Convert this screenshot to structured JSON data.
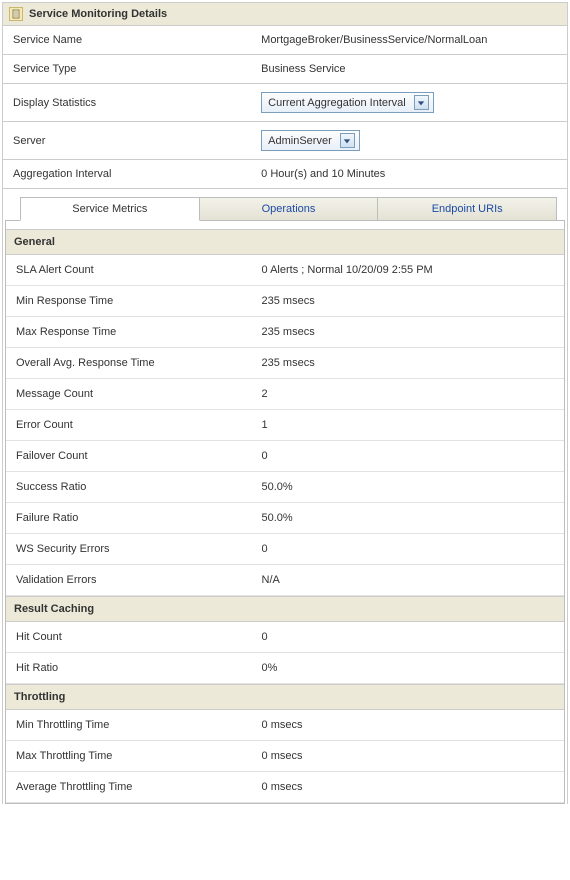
{
  "header": {
    "title": "Service Monitoring Details",
    "icon_name": "document-icon"
  },
  "info": {
    "rows": [
      {
        "label": "Service Name",
        "type": "text",
        "value": "MortgageBroker/BusinessService/NormalLoan"
      },
      {
        "label": "Service Type",
        "type": "text",
        "value": "Business Service"
      },
      {
        "label": "Display Statistics",
        "type": "select",
        "value": "Current Aggregation Interval"
      },
      {
        "label": "Server",
        "type": "select",
        "value": "AdminServer"
      },
      {
        "label": "Aggregation Interval",
        "type": "text",
        "value": "0 Hour(s) and 10 Minutes"
      }
    ]
  },
  "tabs": {
    "items": [
      {
        "label": "Service Metrics",
        "active": true
      },
      {
        "label": "Operations",
        "active": false
      },
      {
        "label": "Endpoint URIs",
        "active": false
      }
    ]
  },
  "sections": [
    {
      "title": "General",
      "rows": [
        {
          "label": "SLA Alert Count",
          "value": "0 Alerts ; Normal 10/20/09 2:55 PM"
        },
        {
          "label": "Min Response Time",
          "value": "235 msecs"
        },
        {
          "label": "Max Response Time",
          "value": "235 msecs"
        },
        {
          "label": "Overall Avg. Response Time",
          "value": "235 msecs"
        },
        {
          "label": "Message Count",
          "value": "2"
        },
        {
          "label": "Error Count",
          "value": "1"
        },
        {
          "label": "Failover Count",
          "value": "0"
        },
        {
          "label": "Success Ratio",
          "value": "50.0%"
        },
        {
          "label": "Failure Ratio",
          "value": "50.0%"
        },
        {
          "label": "WS Security Errors",
          "value": "0"
        },
        {
          "label": "Validation Errors",
          "value": "N/A"
        }
      ]
    },
    {
      "title": "Result Caching",
      "rows": [
        {
          "label": "Hit Count",
          "value": "0"
        },
        {
          "label": "Hit Ratio",
          "value": "0%"
        }
      ]
    },
    {
      "title": "Throttling",
      "rows": [
        {
          "label": "Min Throttling Time",
          "value": "0 msecs"
        },
        {
          "label": "Max Throttling Time",
          "value": "0 msecs"
        },
        {
          "label": "Average Throttling Time",
          "value": "0 msecs"
        }
      ]
    }
  ]
}
